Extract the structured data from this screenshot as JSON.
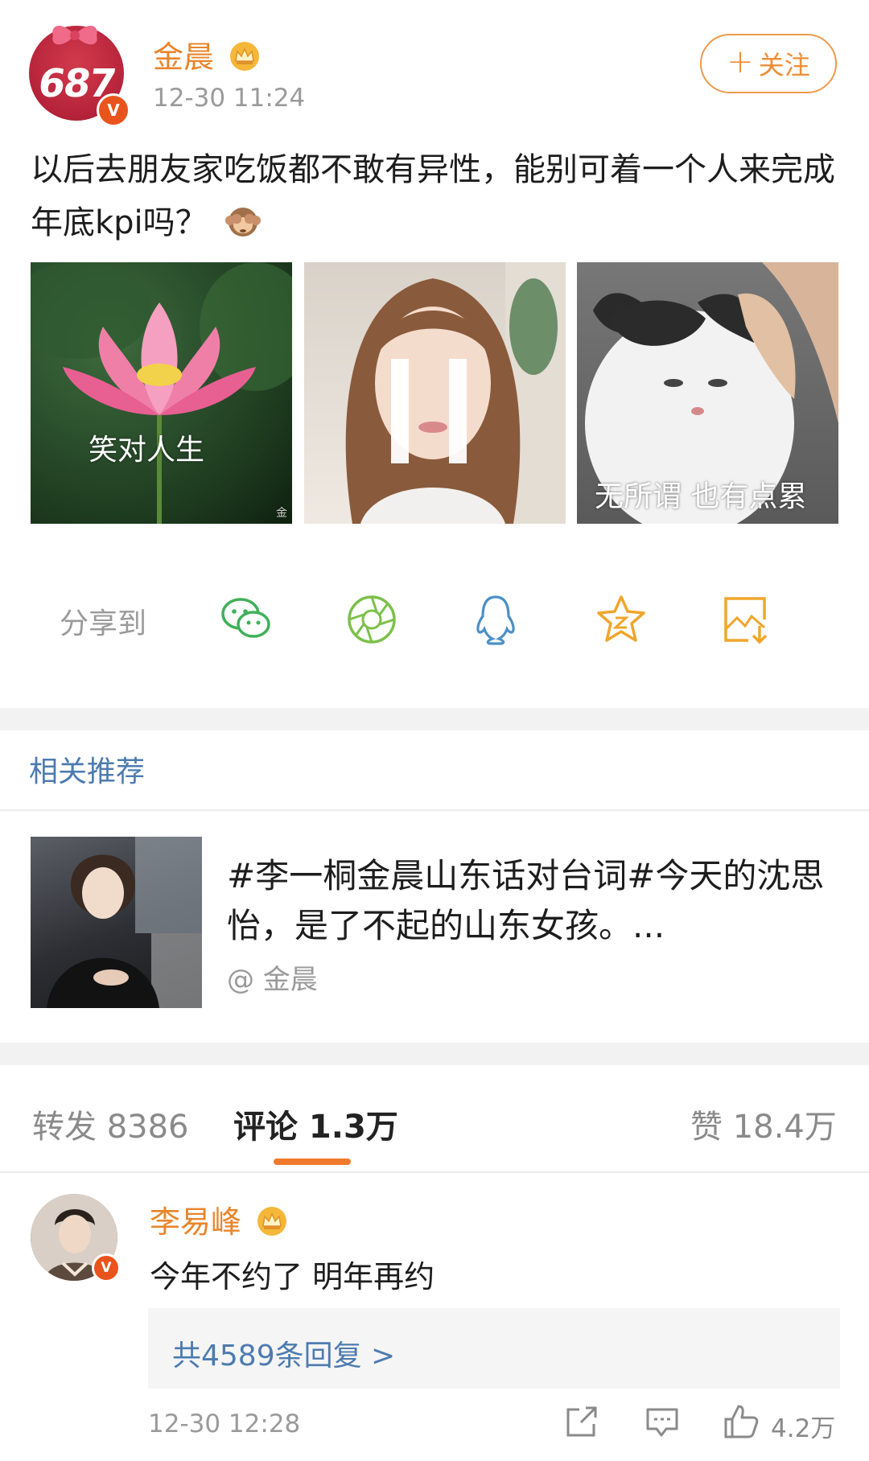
{
  "post": {
    "avatar_number": "687",
    "verified_badge": "V",
    "author": "金晨",
    "author_badge": "crown-icon",
    "time": "12-30 11:24",
    "follow_plus": "+",
    "follow_label": "关注",
    "text": "以后去朋友家吃饭都不敢有异性，能别可着一个人来完成年底kpi吗？",
    "emoji": "see-no-evil-monkey",
    "images": [
      {
        "caption": "笑对人生",
        "watermark": "金"
      },
      {
        "caption": "",
        "watermark": ""
      },
      {
        "caption": "无所谓 也有点累",
        "watermark": ""
      }
    ]
  },
  "share": {
    "label": "分享到",
    "icons": [
      "wechat-icon",
      "moments-icon",
      "qq-icon",
      "favorite-star-icon",
      "save-image-icon"
    ],
    "colors": {
      "wechat": "#3fb05a",
      "moments": "#7cc04a",
      "qq": "#4a90c8",
      "star": "#f0a52c",
      "save": "#f0a52c"
    }
  },
  "related": {
    "title": "相关推荐",
    "item_title": "#李一桐金晨山东话对台词#今天的沈思怡，是了不起的山东女孩。...",
    "item_source": "@ 金晨"
  },
  "tabs": {
    "repost": "转发 8386",
    "comments": "评论 1.3万",
    "likes": "赞 18.4万"
  },
  "comment": {
    "author": "李易峰",
    "verified_badge": "V",
    "text": "今年不约了 明年再约",
    "reply_link": "共4589条回复 >",
    "time": "12-30 12:28",
    "like_count": "4.2万"
  },
  "colors": {
    "accent_orange": "#e8852c",
    "link_blue": "#4d7bb0",
    "tab_underline": "#f07a2c"
  }
}
